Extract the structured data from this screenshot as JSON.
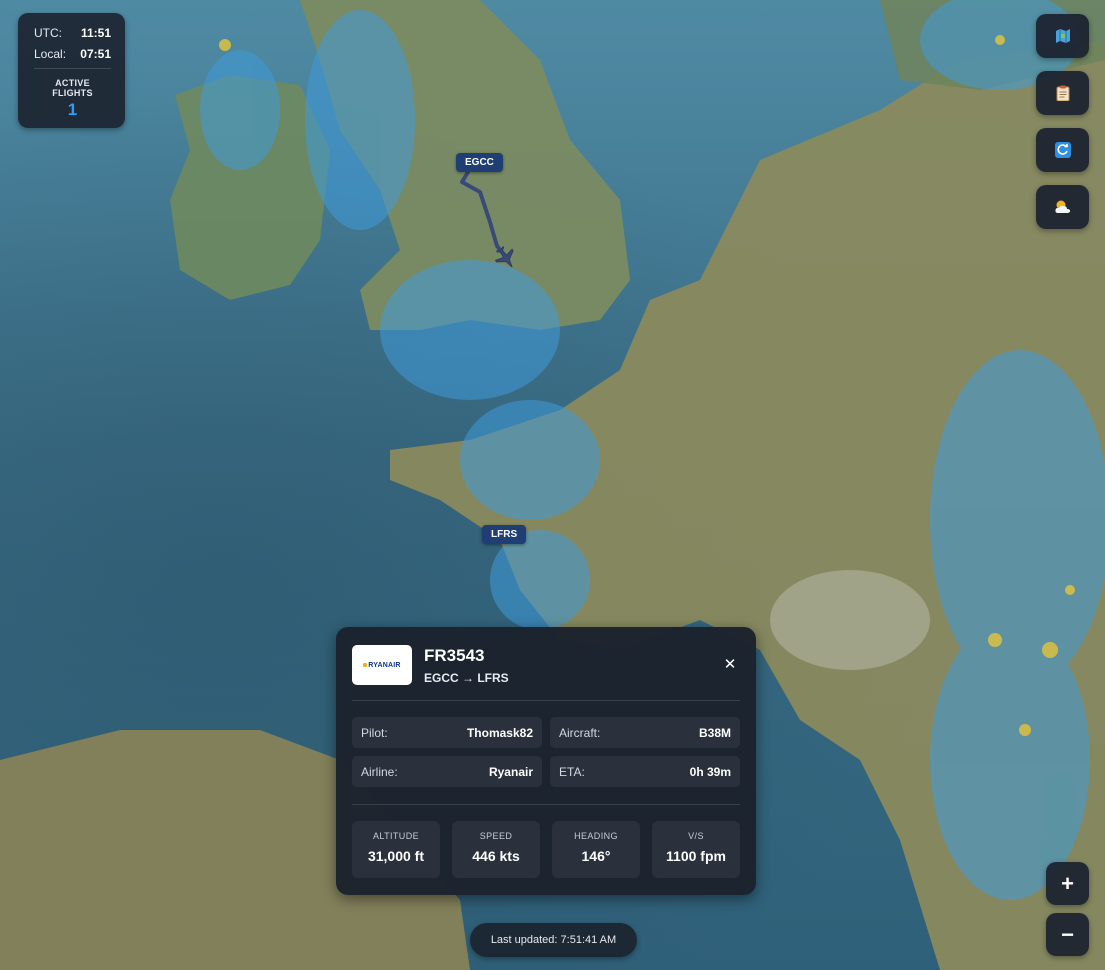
{
  "clock": {
    "utc_label": "UTC:",
    "utc_time": "11:51",
    "local_label": "Local:",
    "local_time": "07:51",
    "active_flights_label": "ACTIVE FLIGHTS",
    "active_flights_count": "1"
  },
  "controls": [
    {
      "name": "map-layer-button",
      "icon": "map-icon"
    },
    {
      "name": "flight-log-button",
      "icon": "clipboard-icon"
    },
    {
      "name": "refresh-button",
      "icon": "refresh-icon"
    },
    {
      "name": "weather-button",
      "icon": "weather-icon"
    }
  ],
  "zoom": {
    "in_label": "+",
    "out_label": "−"
  },
  "airports": {
    "departure": "EGCC",
    "arrival": "LFRS"
  },
  "flight": {
    "airline_logo_text": "RYANAIR",
    "callsign": "FR3543",
    "route": "EGCC → LFRS",
    "close_label": "✕",
    "details": {
      "pilot_label": "Pilot:",
      "pilot": "Thomask82",
      "aircraft_label": "Aircraft:",
      "aircraft": "B38M",
      "airline_label": "Airline:",
      "airline": "Ryanair",
      "eta_label": "ETA:",
      "eta": "0h 39m"
    },
    "stats": {
      "altitude_label": "ALTITUDE",
      "altitude": "31,000 ft",
      "speed_label": "SPEED",
      "speed": "446 kts",
      "heading_label": "HEADING",
      "heading": "146°",
      "vs_label": "V/S",
      "vs": "1100 fpm"
    }
  },
  "last_updated": "Last updated: 7:51:41 AM",
  "colors": {
    "panel_bg": "#1c2430",
    "accent_blue": "#2f9cf5",
    "airport_tag": "#1f3f74",
    "route_line": "#3a4a78",
    "ryanair_blue": "#073590",
    "ryanair_yellow": "#f2b01e"
  }
}
